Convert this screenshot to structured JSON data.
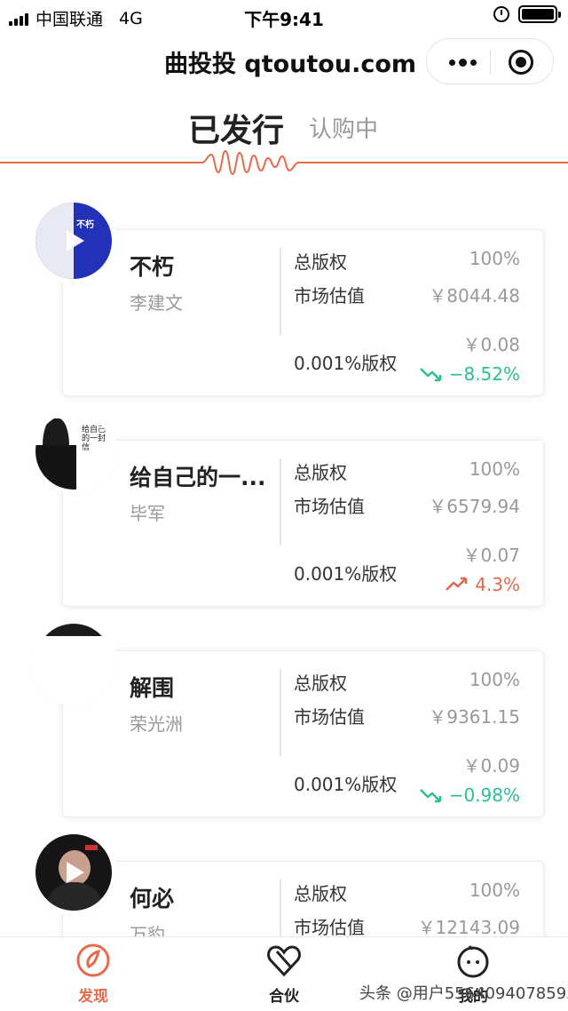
{
  "status_bar": {
    "carrier": "中国联通",
    "network": "4G",
    "time": "下午9:41"
  },
  "header": {
    "title": "曲投投 qtoutou.com"
  },
  "tabs": {
    "issued": "已发行",
    "subscribing": "认购中"
  },
  "labels": {
    "total_rights": "总版权",
    "market_value": "市场估值",
    "share_rights": "0.001%版权"
  },
  "colors": {
    "accent": "#e86a4a",
    "down": "#2bbf93",
    "up": "#e5674b"
  },
  "songs": [
    {
      "title": "不朽",
      "artist": "李建文",
      "total": "100%",
      "market": "￥8044.48",
      "price": "￥0.08",
      "change": "−8.52%",
      "trend": "down",
      "cover_text": "不朽"
    },
    {
      "title": "给自己的一...",
      "artist": "毕军",
      "total": "100%",
      "market": "￥6579.94",
      "price": "￥0.07",
      "change": "4.3%",
      "trend": "up",
      "cover_text": "给自己的一封信"
    },
    {
      "title": "解围",
      "artist": "荣光洲",
      "total": "100%",
      "market": "￥9361.15",
      "price": "￥0.09",
      "change": "−0.98%",
      "trend": "down",
      "cover_text": ""
    },
    {
      "title": "何必",
      "artist": "万豹",
      "total": "100%",
      "market": "￥12143.09",
      "price": "",
      "change": "",
      "trend": "",
      "cover_text": ""
    }
  ],
  "tabbar": {
    "discover": "发现",
    "partner": "合伙",
    "mine": "我的"
  },
  "watermark": "头条 @用户5564094078593"
}
